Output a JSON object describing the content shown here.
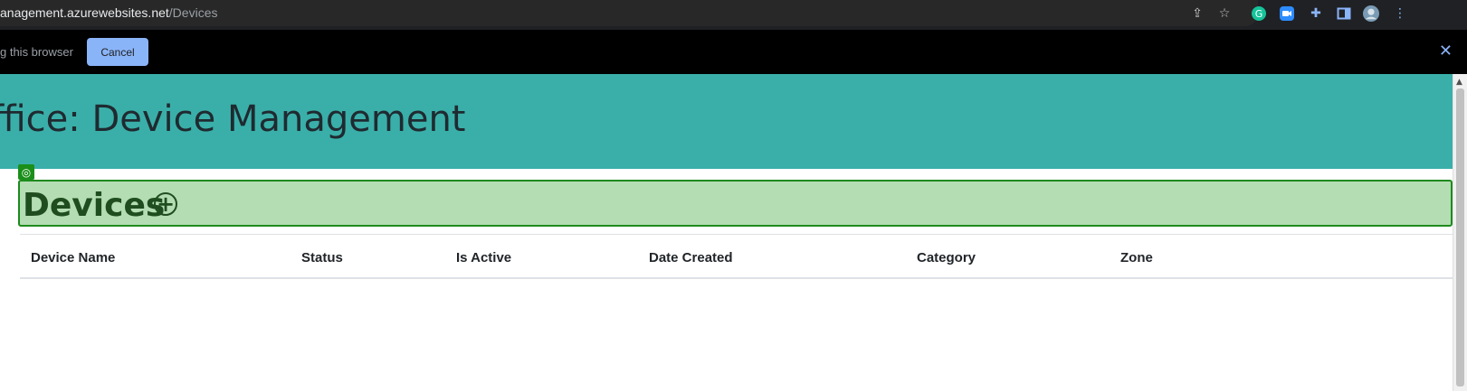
{
  "browser": {
    "url_host": "anagement.azurewebsites.net",
    "url_path": "/Devices",
    "icons": [
      "share-icon",
      "star-icon",
      "grammarly-icon",
      "zoom-icon",
      "extensions-icon",
      "sidepanel-icon",
      "profile-avatar",
      "menu-icon"
    ]
  },
  "share_banner": {
    "text": "g this browser",
    "cancel_label": "Cancel",
    "close_label": "✕"
  },
  "app": {
    "title": "ffice: Device Management"
  },
  "section": {
    "badge": "◎",
    "title": "Devices",
    "add_symbol": "+"
  },
  "table": {
    "columns": [
      "Device Name",
      "Status",
      "Is Active",
      "Date Created",
      "Category",
      "Zone"
    ],
    "rows": []
  },
  "colors": {
    "header_bg": "#3aafa9",
    "highlight_bg": "#b4ddb4",
    "highlight_border": "#1e8a1e",
    "cancel_bg": "#8ab4f8"
  }
}
